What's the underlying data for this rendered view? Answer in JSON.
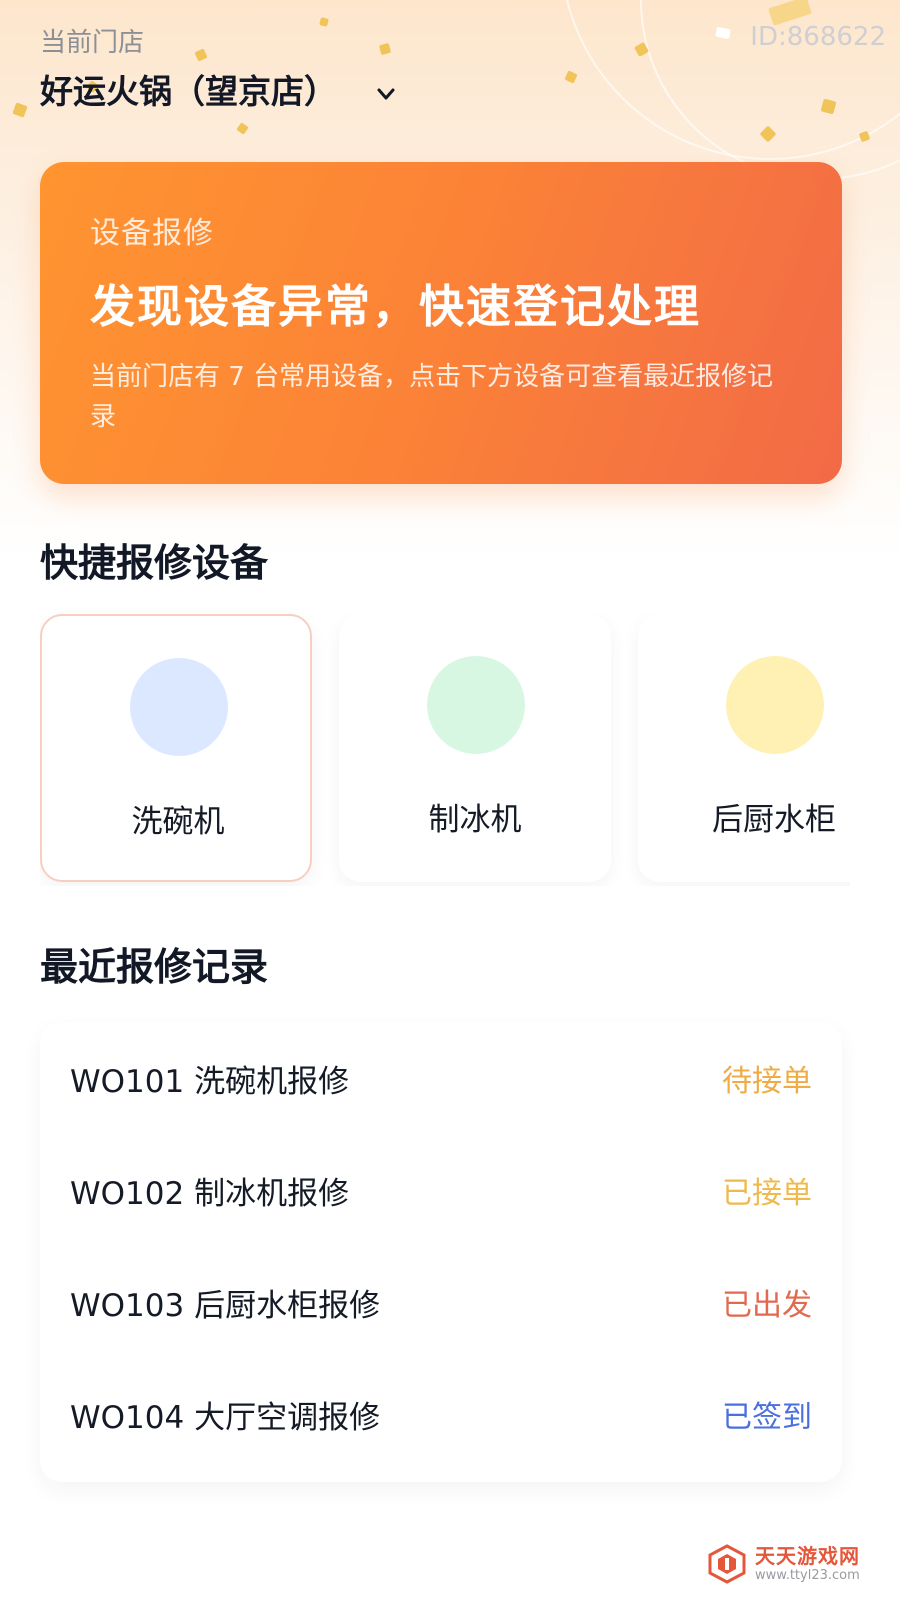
{
  "store": {
    "label": "当前门店",
    "id_text": "ID:868622",
    "name": "好运火锅（望京店）",
    "dropdown_icon": "chevron-down-icon"
  },
  "banner": {
    "kicker": "设备报修",
    "title": "发现设备异常，快速登记处理",
    "description": "当前门店有 7 台常用设备，点击下方设备可查看最近报修记录",
    "colors": {
      "from": "#ff9430",
      "to": "#f26a47"
    }
  },
  "quick_devices": {
    "title": "快捷报修设备",
    "items": [
      {
        "name": "洗碗机",
        "color": "#dbe8ff",
        "selected": true
      },
      {
        "name": "制冰机",
        "color": "#d7f7e3",
        "selected": false
      },
      {
        "name": "后厨水柜",
        "color": "#fff1b3",
        "selected": false
      }
    ]
  },
  "recent_records": {
    "title": "最近报修记录",
    "items": [
      {
        "title": "WO101 洗碗机报修",
        "status": "待接单",
        "status_color": "#efac45"
      },
      {
        "title": "WO102 制冰机报修",
        "status": "已接单",
        "status_color": "#efb94c"
      },
      {
        "title": "WO103 后厨水柜报修",
        "status": "已出发",
        "status_color": "#e2694d"
      },
      {
        "title": "WO104 大厅空调报修",
        "status": "已签到",
        "status_color": "#4b6fde"
      }
    ]
  },
  "watermark": {
    "name": "天天游戏网",
    "url": "www.ttyl23.com",
    "icon": "ttyl-logo-icon"
  }
}
